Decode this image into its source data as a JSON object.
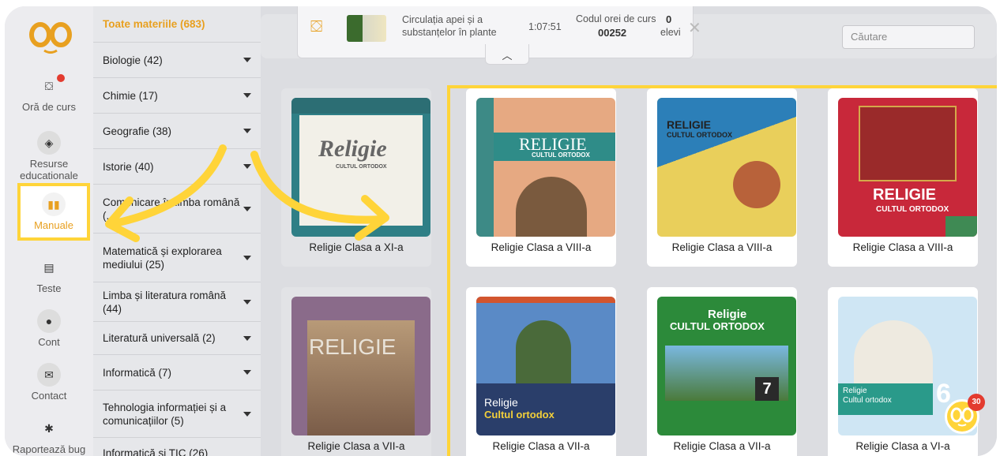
{
  "rail": {
    "items": [
      {
        "label": "Oră de curs",
        "icon": "chalkboard-icon"
      },
      {
        "label": "Resurse educationale",
        "icon": "cube-icon"
      },
      {
        "label": "Manuale",
        "icon": "book-icon"
      },
      {
        "label": "Teste",
        "icon": "document-icon"
      },
      {
        "label": "Cont",
        "icon": "user-icon"
      },
      {
        "label": "Contact",
        "icon": "envelope-icon"
      },
      {
        "label": "Raportează bug",
        "icon": "bug-icon"
      }
    ]
  },
  "categories": [
    {
      "label": "Toate materiile (683)"
    },
    {
      "label": "Biologie (42)"
    },
    {
      "label": "Chimie (17)"
    },
    {
      "label": "Geografie (38)"
    },
    {
      "label": "Istorie (40)"
    },
    {
      "label": "Comunicare în limba română (..."
    },
    {
      "label": "Matematică și explorarea mediului (25)"
    },
    {
      "label": "Limba și literatura română (44)"
    },
    {
      "label": "Literatură universală (2)"
    },
    {
      "label": "Informatică (7)"
    },
    {
      "label": "Tehnologia informației și a comunicațiilor (5)"
    },
    {
      "label": "Informatică și TIC (26)"
    }
  ],
  "lesson": {
    "title": "Circulația apei și a substanțelor în plante",
    "time": "1:07:51",
    "code_label": "Codul orei de curs",
    "code": "00252",
    "students_count": "0",
    "students_label": "elevi"
  },
  "search": {
    "placeholder": "Căutare"
  },
  "books_left": [
    {
      "caption": "Religie Clasa a XI-a",
      "cover_title": "Religie",
      "cover_sub": "CULTUL ORTODOX"
    },
    {
      "caption": "Religie Clasa a VII-a",
      "cover_title": "RELIGIE"
    }
  ],
  "books": [
    {
      "caption": "Religie Clasa a VIII-a",
      "cover_title": "RELIGIE",
      "cover_sub": "CULTUL ORTODOX"
    },
    {
      "caption": "Religie Clasa a VIII-a",
      "cover_title": "RELIGIE",
      "cover_sub": "CULTUL ORTODOX"
    },
    {
      "caption": "Religie Clasa a VIII-a",
      "cover_title": "RELIGIE",
      "cover_sub": "CULTUL ORTODOX"
    },
    {
      "caption": "Religie Clasa a VII-a",
      "cover_title": "Religie",
      "cover_sub": "Cultul ortodox"
    },
    {
      "caption": "Religie Clasa a VII-a",
      "cover_title": "Religie",
      "cover_sub": "CULTUL ORTODOX"
    },
    {
      "caption": "Religie Clasa a VI-a",
      "cover_title": "Religie",
      "cover_sub": "Cultul ortodox"
    }
  ],
  "notification_count": "30",
  "colors": {
    "accent": "#ffd439",
    "brand": "#e8a020",
    "alert": "#e33b2f"
  }
}
